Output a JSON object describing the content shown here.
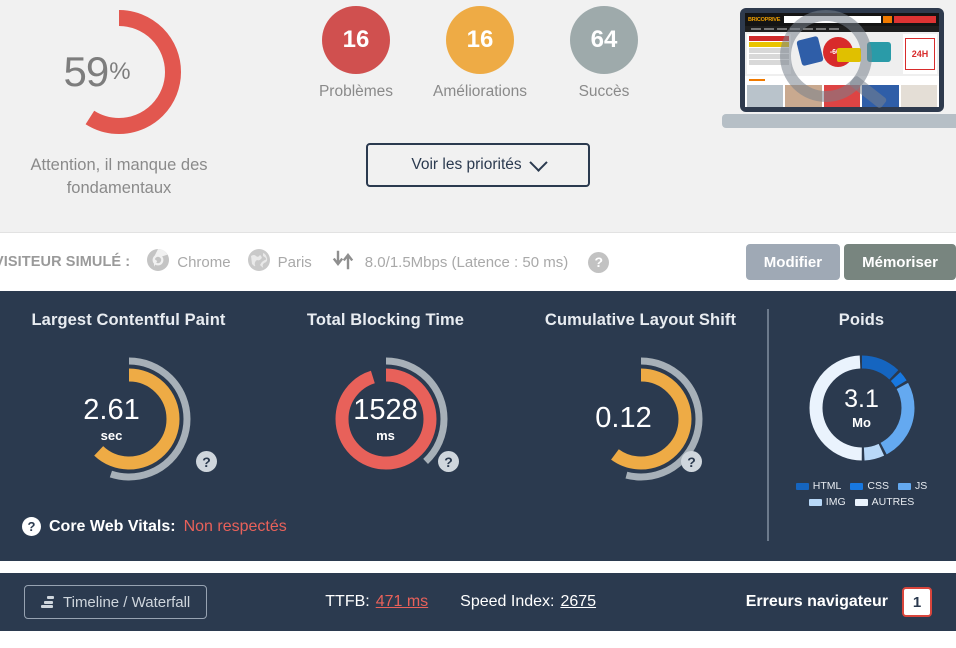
{
  "summary": {
    "score": {
      "value": "59",
      "suffix": "%",
      "percent": 59,
      "color": "#e2574f",
      "caption": "Attention, il manque des fondamentaux"
    },
    "counters": [
      {
        "count": "16",
        "label": "Problèmes",
        "color": "#d0504f"
      },
      {
        "count": "16",
        "label": "Améliorations",
        "color": "#eeab45"
      },
      {
        "count": "64",
        "label": "Succès",
        "color": "#9eaaab"
      }
    ],
    "priorities_button": "Voir les priorités",
    "priorities_icon": "chevron-down-icon",
    "preview": {
      "site_name": "BRICOPRIVE",
      "promo_badge": "-60%",
      "shipping_badge": "24H",
      "category_label": "GAMME ELECTROPORTATIVE",
      "overlay_icon": "magnifier-icon"
    }
  },
  "visitor": {
    "label": "VISITEUR SIMULÉ :",
    "browser": {
      "icon": "chrome-icon",
      "name": "Chrome"
    },
    "location": {
      "icon": "globe-icon",
      "name": "Paris"
    },
    "network": {
      "icon": "download-upload-arrows-icon",
      "text": "8.0/1.5Mbps (Latence : 50 ms)"
    },
    "help_icon": "help-icon",
    "buttons": {
      "modify": "Modifier",
      "memorize": "Mémoriser"
    }
  },
  "metrics": {
    "lcp": {
      "title": "Largest Contentful Paint",
      "value": "2.61",
      "unit": "sec",
      "color": "#eeab45",
      "inner_percent": 62,
      "outer_percent": 55,
      "help_icon": "help-icon"
    },
    "tbt": {
      "title": "Total Blocking Time",
      "value": "1528",
      "unit": "ms",
      "color": "#e8615a",
      "inner_percent": 95,
      "outer_percent": 38,
      "help_icon": "help-icon"
    },
    "cls": {
      "title": "Cumulative Layout Shift",
      "value": "0.12",
      "unit": "",
      "color": "#eeab45",
      "inner_percent": 60,
      "outer_percent": 54,
      "help_icon": "help-icon"
    },
    "poids": {
      "title": "Poids",
      "value": "3.1",
      "unit": "Mo",
      "legend": [
        {
          "label": "HTML",
          "color": "#1565c0",
          "percent": 13
        },
        {
          "label": "CSS",
          "color": "#1878e0",
          "percent": 4
        },
        {
          "label": "JS",
          "color": "#64a9f0",
          "percent": 26
        },
        {
          "label": "IMG",
          "color": "#b8d8f8",
          "percent": 7
        },
        {
          "label": "AUTRES",
          "color": "#eaf3fd",
          "percent": 50
        }
      ]
    },
    "core_web_vitals": {
      "icon": "help-icon",
      "label": "Core Web Vitals:",
      "status": "Non respectés",
      "status_color": "#e8615a"
    }
  },
  "bottom": {
    "waterfall_button": "Timeline / Waterfall",
    "waterfall_icon": "waterfall-icon",
    "ttfb_label": "TTFB:",
    "ttfb_value": "471 ms",
    "speed_index_label": "Speed Index:",
    "speed_index_value": "2675",
    "errors_label": "Erreurs navigateur",
    "errors_count": "1"
  }
}
